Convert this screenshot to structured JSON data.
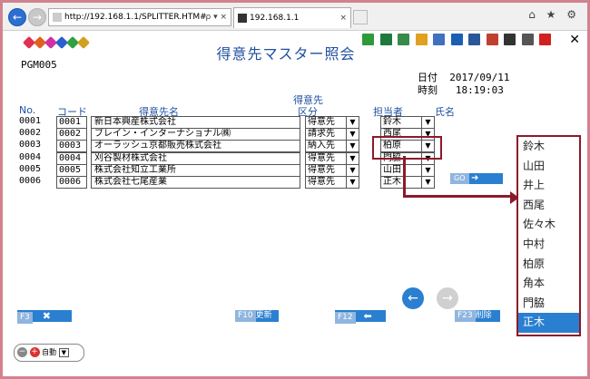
{
  "browser": {
    "url": "http://192.168.1.1/SPLITTER.HTM#",
    "url_tools": "ρ ▾ ×",
    "tab_title": "192.168.1.1",
    "tab_close": "×",
    "window_icons": "⌂ ★ ⚙"
  },
  "app": {
    "title": "得意先マスター照会",
    "program_id": "PGM005",
    "date_label": "日付",
    "date_value": "2017/09/11",
    "time_label": "時刻",
    "time_value": "18:19:03",
    "close": "✕"
  },
  "headers": {
    "no": "No.",
    "code": "コード",
    "name": "得意先名",
    "kubun_top": "得意先",
    "kubun": "区分",
    "tanto": "担当者",
    "shimei": "氏名"
  },
  "rows": [
    {
      "no": "0001",
      "code": "0001",
      "name": "新日本興産株式会社",
      "kubun": "得意先",
      "tanto": "鈴木"
    },
    {
      "no": "0002",
      "code": "0002",
      "name": "ブレイン・インターナショナル㈱",
      "kubun": "請求先",
      "tanto": "西尾"
    },
    {
      "no": "0003",
      "code": "0003",
      "name": "オーラッシュ京都販売株式会社",
      "kubun": "納入先",
      "tanto": "柏原"
    },
    {
      "no": "0004",
      "code": "0004",
      "name": "刈谷製材株式会社",
      "kubun": "得意先",
      "tanto": "門脇"
    },
    {
      "no": "0005",
      "code": "0005",
      "name": "株式会社知立工業所",
      "kubun": "得意先",
      "tanto": "山田"
    },
    {
      "no": "0006",
      "code": "0006",
      "name": "株式会社七尾産業",
      "kubun": "得意先",
      "tanto": "正木"
    }
  ],
  "buttons": {
    "go": "GO",
    "f3": "F3",
    "f10": "F10",
    "f10_label": "更新",
    "f12": "F12",
    "f23": "F23",
    "f23_label": "削除"
  },
  "zoom": {
    "value": "自動"
  },
  "dropdown": {
    "options": [
      "鈴木",
      "山田",
      "井上",
      "西尾",
      "佐々木",
      "中村",
      "柏原",
      "角本",
      "門脇",
      "正木"
    ],
    "selected": "正木"
  },
  "colors": {
    "accent": "#2a7fd0",
    "callout": "#8b1a2b",
    "title": "#2050a0"
  }
}
